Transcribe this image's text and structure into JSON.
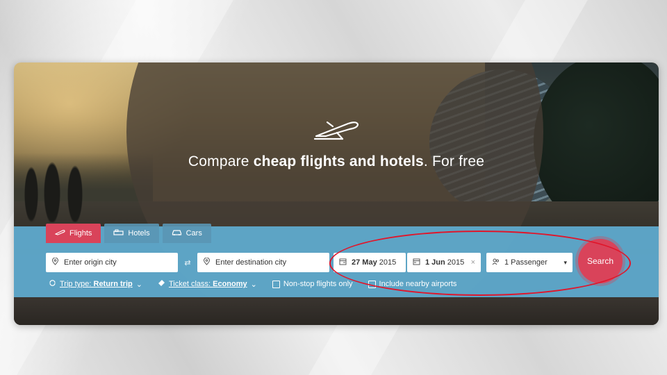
{
  "hero": {
    "headline_prefix": "Compare ",
    "headline_bold": "cheap flights and hotels",
    "headline_suffix": ". For free"
  },
  "tabs": [
    {
      "label": "Flights",
      "icon": "plane-icon",
      "active": true
    },
    {
      "label": "Hotels",
      "icon": "bed-icon",
      "active": false
    },
    {
      "label": "Cars",
      "icon": "car-icon",
      "active": false
    }
  ],
  "search": {
    "origin_placeholder": "Enter origin city",
    "destination_placeholder": "Enter destination city",
    "depart_day": "27 May",
    "depart_year": " 2015",
    "return_day": "1 Jun",
    "return_year": " 2015",
    "clear": "×",
    "passengers": "1 Passenger",
    "button": "Search"
  },
  "options": {
    "trip_type_label": "Trip type: ",
    "trip_type_value": "Return trip",
    "ticket_class_label": "Ticket class: ",
    "ticket_class_value": "Economy",
    "nonstop": "Non-stop flights only",
    "nearby": "Include nearby airports"
  },
  "colors": {
    "accent": "#d9435a",
    "band": "#5faacd",
    "annotation": "#e0162b"
  }
}
